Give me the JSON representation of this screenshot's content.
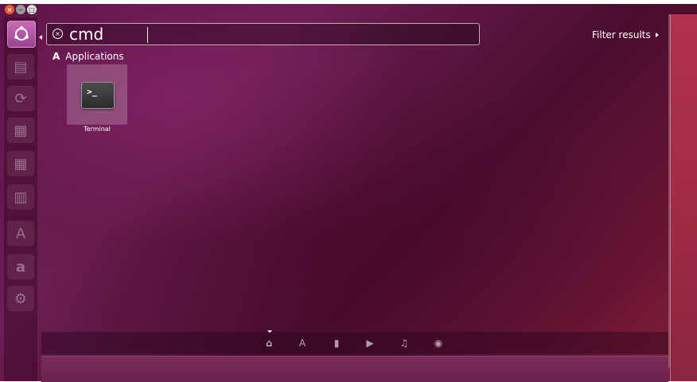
{
  "search": {
    "query": "cmd"
  },
  "filter": {
    "label": "Filter results"
  },
  "category": {
    "name": "Applications"
  },
  "results": [
    {
      "label": "Terminal",
      "icon": "terminal-icon"
    }
  ],
  "launcher": {
    "items": [
      {
        "icon": "ubuntu-dash-icon"
      },
      {
        "icon": "files-icon"
      },
      {
        "icon": "software-updater-icon"
      },
      {
        "icon": "writer-icon"
      },
      {
        "icon": "calc-icon"
      },
      {
        "icon": "impress-icon"
      },
      {
        "icon": "software-center-icon"
      },
      {
        "icon": "amazon-icon"
      },
      {
        "icon": "system-settings-icon"
      }
    ]
  },
  "lenses": [
    {
      "icon": "home-icon",
      "active": true
    },
    {
      "icon": "applications-icon"
    },
    {
      "icon": "files-icon"
    },
    {
      "icon": "video-icon"
    },
    {
      "icon": "music-icon"
    },
    {
      "icon": "photos-icon"
    }
  ],
  "colors": {
    "accent": "#9a4392",
    "launcher_highlight": "#c86bb6"
  }
}
